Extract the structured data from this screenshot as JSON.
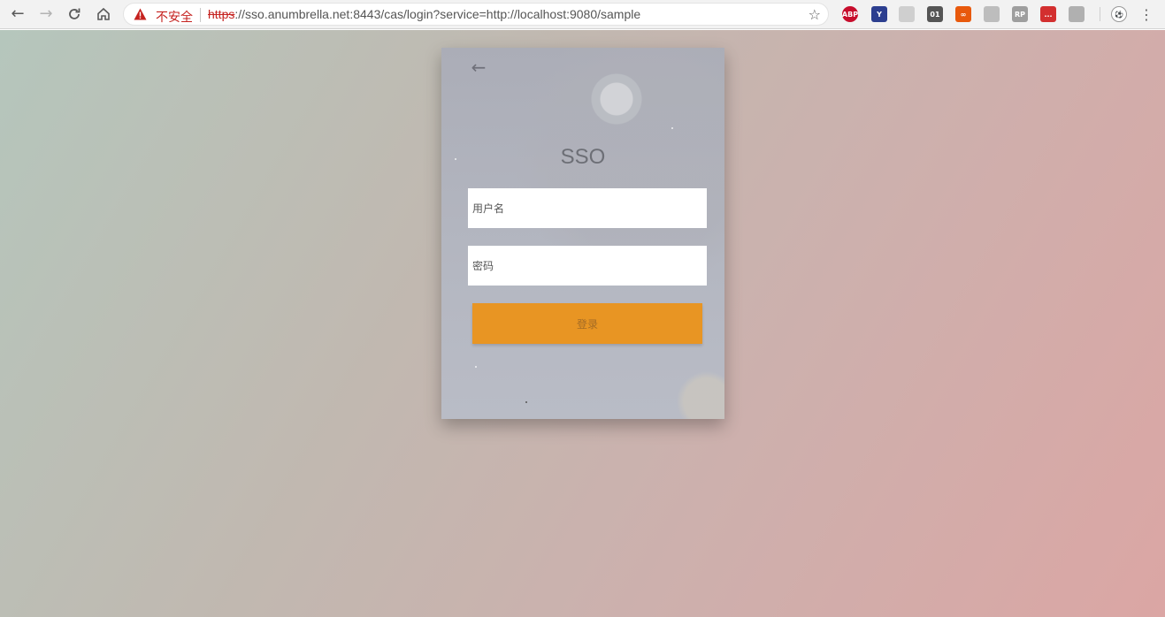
{
  "browser": {
    "url_security_label": "不安全",
    "url_scheme": "https",
    "url_rest": "://sso.anumbrella.net:8443/cas/login?service=http://localhost:9080/sample",
    "extensions": [
      {
        "name": "adblock-plus-icon",
        "label": "ABP",
        "color": "#c70d2c"
      },
      {
        "name": "vue-devtools-icon",
        "label": "Y",
        "color": "#2c3e8f"
      },
      {
        "name": "extension-gray-icon",
        "label": "",
        "color": "#cfcfcf"
      },
      {
        "name": "binary-01-icon",
        "label": "01",
        "color": "#555555"
      },
      {
        "name": "infinity-icon",
        "label": "∞",
        "color": "#e8590c"
      },
      {
        "name": "shield-extension-icon",
        "label": "",
        "color": "#bdbdbd"
      },
      {
        "name": "rp-extension-icon",
        "label": "RP",
        "color": "#9e9e9e"
      },
      {
        "name": "notification-extension-icon",
        "label": "...",
        "color": "#d32f2f"
      },
      {
        "name": "parachute-icon",
        "label": "",
        "color": "#b0b0b0"
      }
    ]
  },
  "login": {
    "title": "SSO",
    "username_placeholder": "用户名",
    "password_placeholder": "密码",
    "submit_label": "登录"
  }
}
